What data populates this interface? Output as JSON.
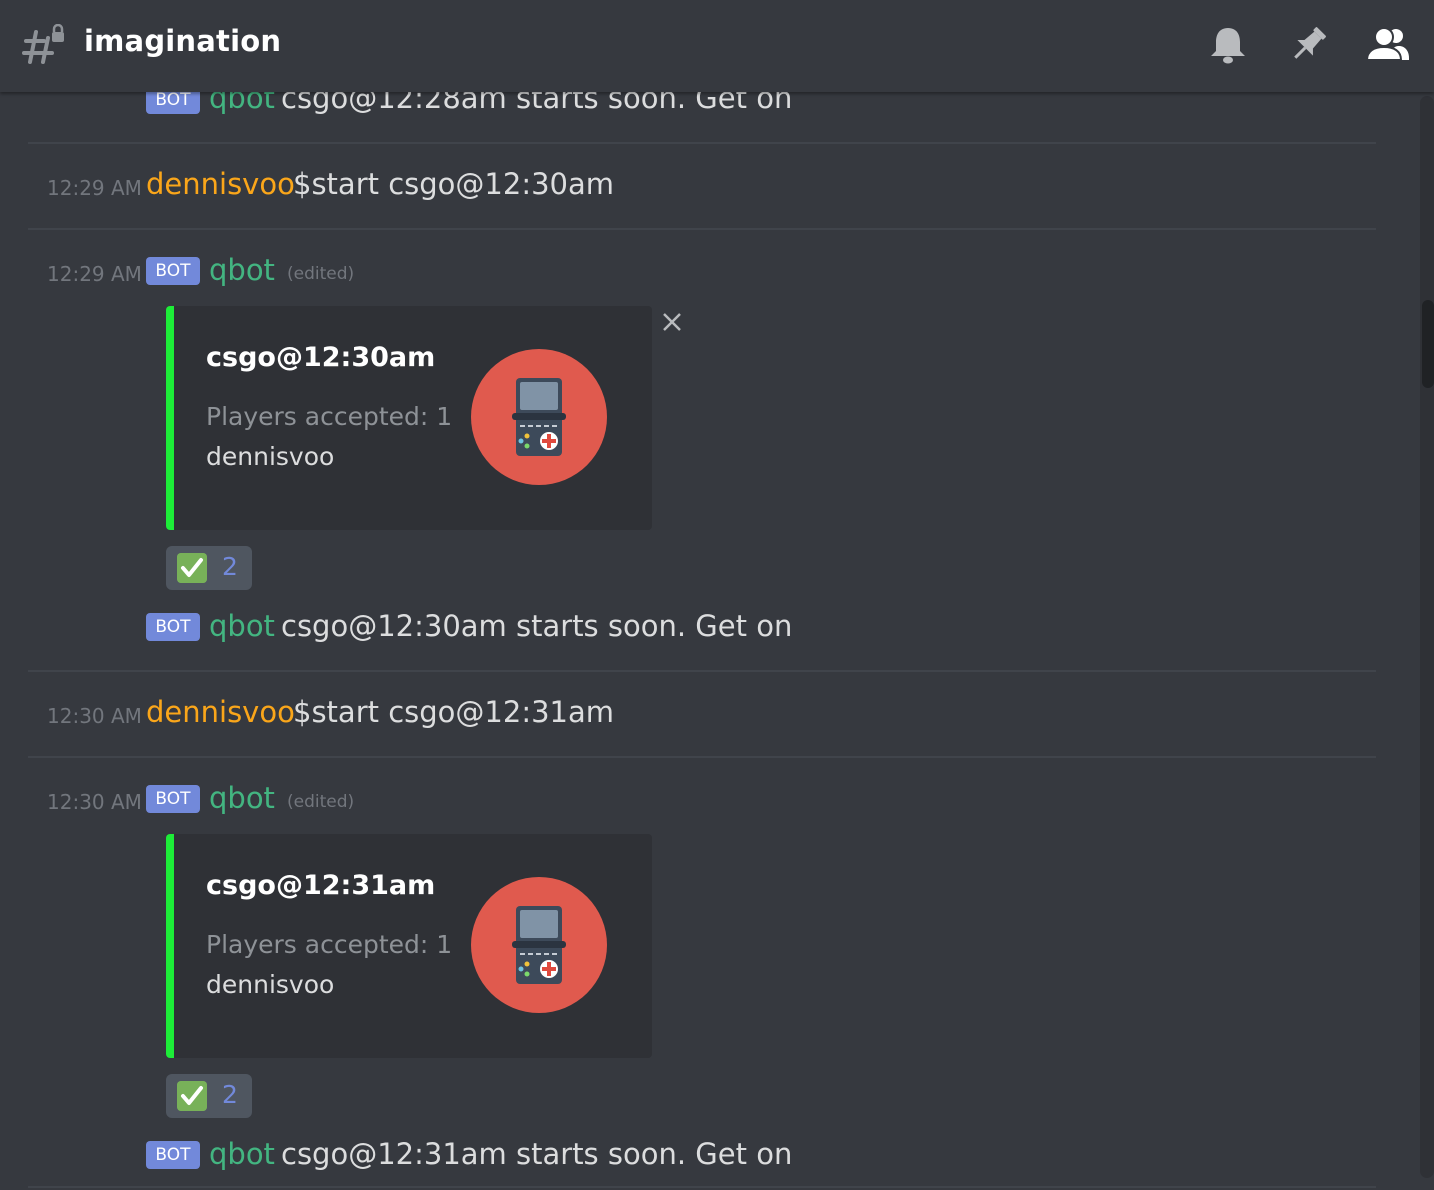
{
  "header": {
    "channel_name": "imagination",
    "icons": [
      "channel-lock-hash-icon",
      "bell-icon",
      "pin-icon",
      "members-icon"
    ]
  },
  "colors": {
    "background": "#36393f",
    "embed_bg": "#2f3136",
    "embed_bar": "#1ded38",
    "bot_tag": "#7289da",
    "bot_name": "#43b581",
    "user_name": "#faa61a",
    "timestamp": "#72767d"
  },
  "bot_tag": "BOT",
  "messages": {
    "m0": {
      "author": "qbot",
      "text": "csgo@12:28am starts soon. Get on"
    },
    "m1": {
      "time": "12:29 AM",
      "author": "dennisvoo",
      "text": "$start csgo@12:30am"
    },
    "m2": {
      "time": "12:29 AM",
      "author": "qbot",
      "edited": "(edited)",
      "embed": {
        "title": "csgo@12:30am",
        "line1": "Players accepted: 1",
        "line2": "dennisvoo",
        "thumbnail": "handheld-game-console-icon"
      },
      "reaction": {
        "emoji": "white-check-mark-icon",
        "count": "2"
      }
    },
    "m3": {
      "author": "qbot",
      "text": "csgo@12:30am starts soon. Get on"
    },
    "m4": {
      "time": "12:30 AM",
      "author": "dennisvoo",
      "text": "$start csgo@12:31am"
    },
    "m5": {
      "time": "12:30 AM",
      "author": "qbot",
      "edited": "(edited)",
      "embed": {
        "title": "csgo@12:31am",
        "line1": "Players accepted: 1",
        "line2": "dennisvoo",
        "thumbnail": "handheld-game-console-icon"
      },
      "reaction": {
        "emoji": "white-check-mark-icon",
        "count": "2"
      }
    },
    "m6": {
      "author": "qbot",
      "text": "csgo@12:31am starts soon. Get on"
    }
  }
}
